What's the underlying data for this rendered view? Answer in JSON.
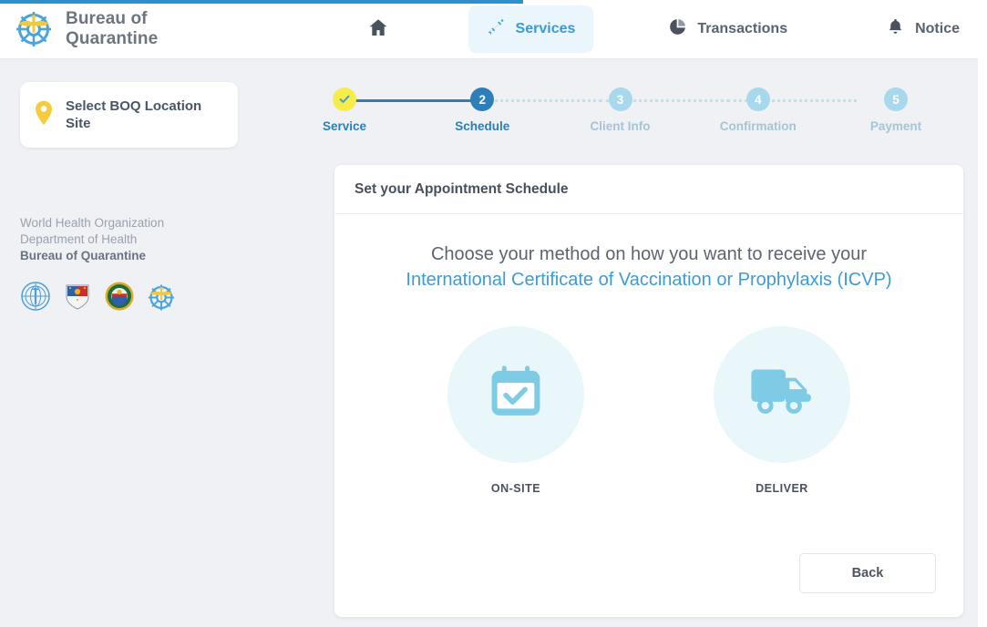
{
  "header": {
    "brand_title": "Bureau of Quarantine",
    "brand_logo_icon": "boq-ship-wheel-caduceus-logo",
    "nav": [
      {
        "label": "",
        "icon": "home-icon",
        "active": false
      },
      {
        "label": "Services",
        "icon": "syringe-icon",
        "active": true
      },
      {
        "label": "Transactions",
        "icon": "pie-chart-icon",
        "active": false
      },
      {
        "label": "Notice",
        "icon": "bell-icon",
        "active": false
      }
    ]
  },
  "top_progress": {
    "percent": 53,
    "color": "#2f8fcc"
  },
  "sidebar": {
    "location_card": {
      "label": "Select BOQ Location Site",
      "icon": "map-pin-icon",
      "pin_color": "#f6cc3f"
    },
    "org_lines": [
      "World Health Organization",
      "Department of Health",
      "Bureau of Quarantine"
    ],
    "logos": [
      "who-logo",
      "philippines-coat-of-arms-logo",
      "department-of-health-seal-logo",
      "bureau-of-quarantine-logo"
    ]
  },
  "stepper": {
    "steps": [
      {
        "number": "1",
        "label": "Service",
        "state": "done",
        "glyph": "check-icon"
      },
      {
        "number": "2",
        "label": "Schedule",
        "state": "active",
        "glyph": "2"
      },
      {
        "number": "3",
        "label": "Client Info",
        "state": "inactive",
        "glyph": "3"
      },
      {
        "number": "4",
        "label": "Confirmation",
        "state": "inactive",
        "glyph": "4"
      },
      {
        "number": "5",
        "label": "Payment",
        "state": "inactive",
        "glyph": "5"
      }
    ],
    "colors": {
      "done": "#f7ed4a",
      "active": "#2c7fb8",
      "inactive": "#a8d8ec"
    }
  },
  "card": {
    "title": "Set your Appointment Schedule",
    "heading_plain_1": "Choose your method on how you want to receive your ",
    "heading_highlight": "International Certificate of Vaccination or Prophylaxis (ICVP)",
    "highlight_color": "#3e9bd4",
    "options": [
      {
        "label": "ON-SITE",
        "icon": "calendar-check-icon"
      },
      {
        "label": "DELIVER",
        "icon": "delivery-truck-icon"
      }
    ],
    "back_label": "Back"
  }
}
